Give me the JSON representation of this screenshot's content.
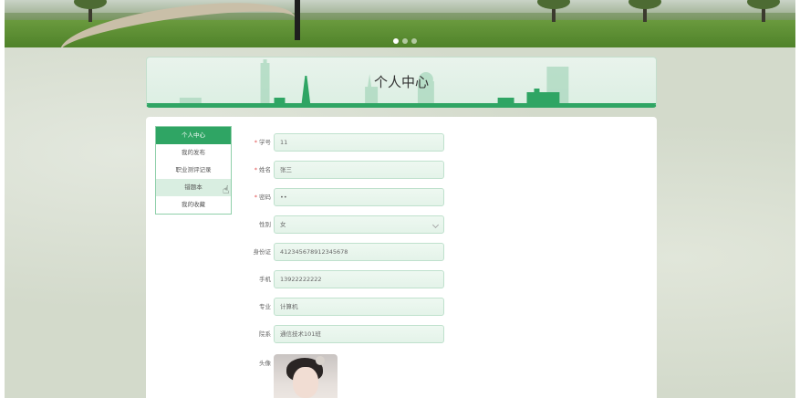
{
  "banner": {
    "slides": [
      {
        "active": true
      },
      {
        "active": false
      },
      {
        "active": false
      }
    ]
  },
  "title": "个人中心",
  "colors": {
    "accent": "#2fa564",
    "field_bg": "#e8f5ec",
    "field_border": "#bfe1cd",
    "required": "#e05050"
  },
  "side_menu": {
    "items": [
      {
        "label": "个人中心",
        "state": "active"
      },
      {
        "label": "我的发布",
        "state": "normal"
      },
      {
        "label": "职业测评记录",
        "state": "normal"
      },
      {
        "label": "错题本",
        "state": "hover"
      },
      {
        "label": "我的收藏",
        "state": "normal"
      }
    ]
  },
  "form": {
    "student_id": {
      "label": "学号",
      "required": true,
      "value": "11"
    },
    "name": {
      "label": "姓名",
      "required": true,
      "value": "张三"
    },
    "password": {
      "label": "密码",
      "required": true,
      "value": "••"
    },
    "gender": {
      "label": "性别",
      "value": "女"
    },
    "id_card": {
      "label": "身份证",
      "value": "412345678912345678"
    },
    "phone": {
      "label": "手机",
      "value": "13922222222"
    },
    "major": {
      "label": "专业",
      "value": "计算机"
    },
    "department": {
      "label": "院系",
      "value": "通信技术101班"
    },
    "avatar": {
      "label": "头像"
    }
  }
}
